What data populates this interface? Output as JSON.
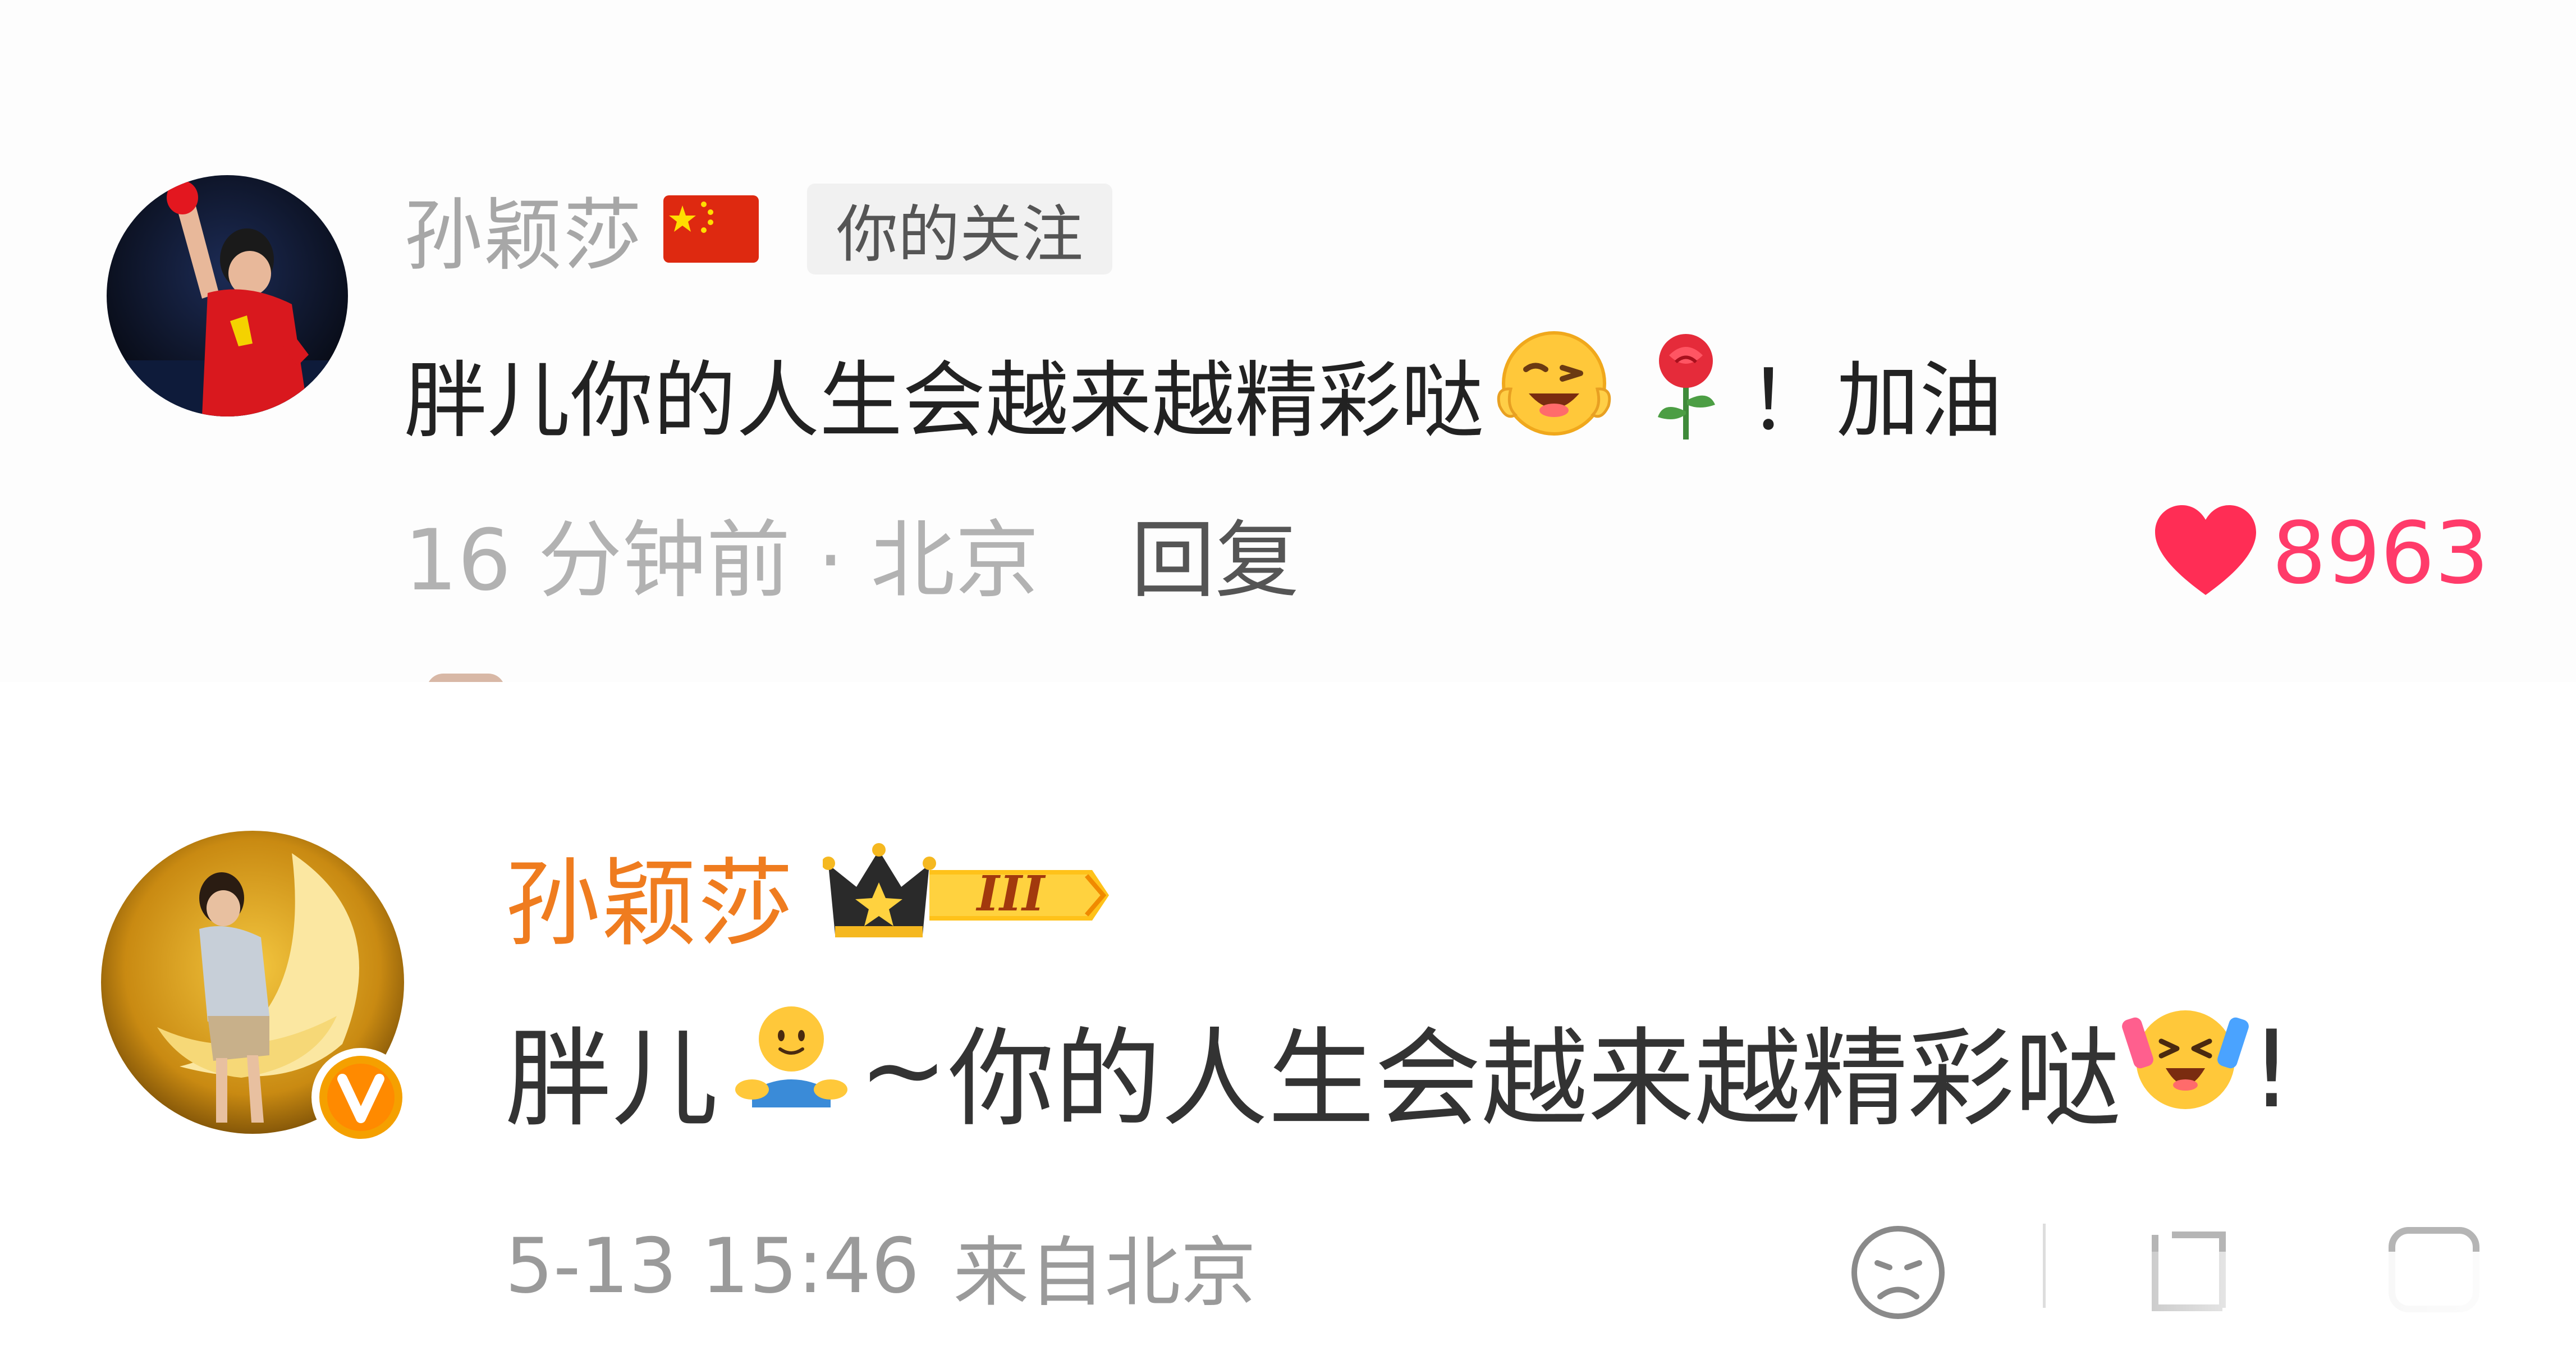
{
  "comment_1": {
    "author_name": "孙颖莎",
    "follow_badge": "你的关注",
    "text_main": "胖儿你的人生会越来越精彩哒",
    "text_punct": "！",
    "text_tail": "加油",
    "emoji_1": "😜",
    "emoji_2": "🌹",
    "time_location": "16 分钟前 · 北京",
    "reply_label": "回复",
    "like_count": "8963",
    "colors": {
      "like": "#ff3b6a",
      "name": "#a7a7a7"
    }
  },
  "comment_2": {
    "author_name": "孙颖莎",
    "badge_level": "III",
    "verified_mark": "V",
    "text_prefix": "胖儿",
    "text_tilde": "~",
    "text_main": "你的人生会越来越精彩哒",
    "text_end": "!",
    "timestamp": "5-13 15:46",
    "source": "来自北京",
    "colors": {
      "name": "#ef7c1f",
      "verified": "#f5a000"
    }
  }
}
